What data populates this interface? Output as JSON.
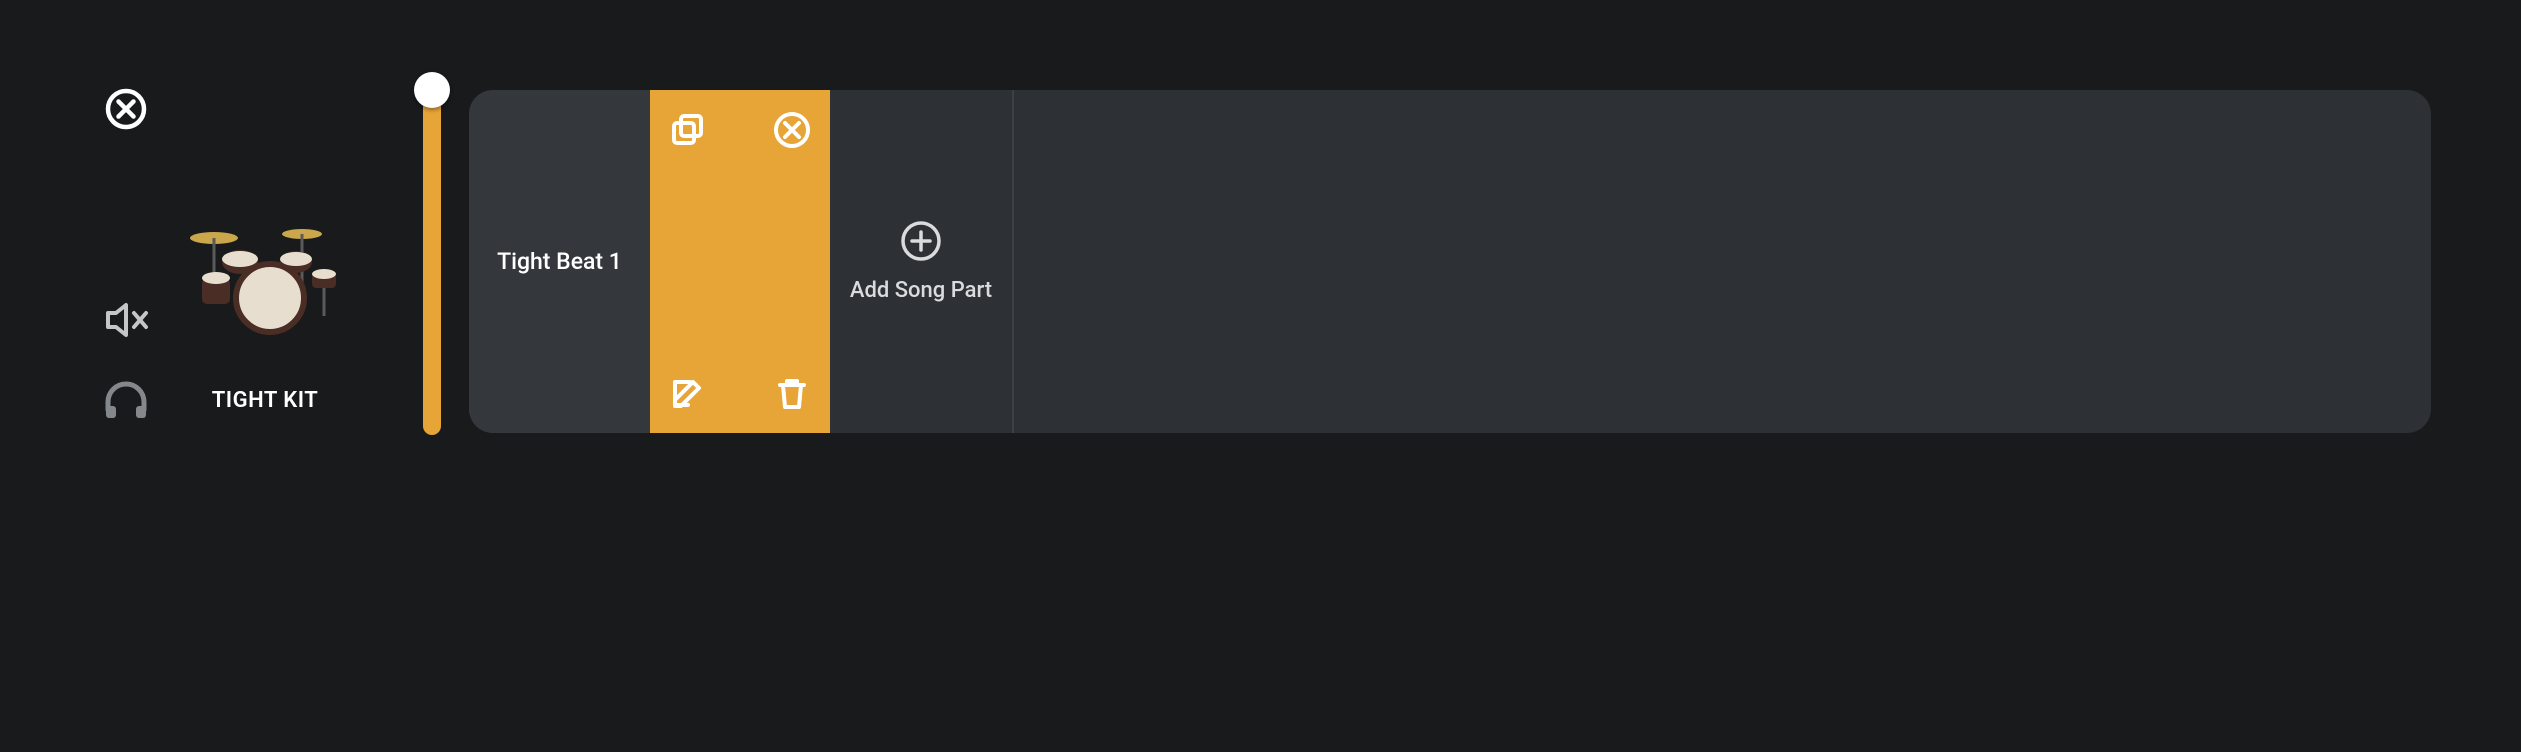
{
  "track": {
    "kit_name": "TIGHT KIT"
  },
  "icons": {
    "close": "close-circle",
    "mute": "speaker-muted",
    "monitor": "headphones",
    "duplicate": "duplicate",
    "remove": "remove-circle",
    "edit": "edit",
    "delete": "trash",
    "add": "plus-circle"
  },
  "lane": {
    "part_name": "Tight Beat 1",
    "add_label": "Add Song Part"
  },
  "colors": {
    "accent": "#e7a538",
    "bg": "#181a1c",
    "lane": "#2d3135",
    "cell": "#34383c"
  },
  "volume": {
    "value_pct": 100
  }
}
